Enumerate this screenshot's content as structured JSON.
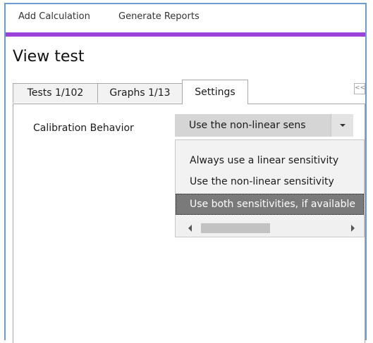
{
  "menu": {
    "items": [
      {
        "label": "Add Calculation"
      },
      {
        "label": "Generate Reports"
      }
    ]
  },
  "colors": {
    "accent": "#9b42d8",
    "window_border": "#6d9bd6",
    "selected_option": "#7a7a7a"
  },
  "page": {
    "title": "View test"
  },
  "tabs": [
    {
      "label": "Tests 1/102"
    },
    {
      "label": "Graphs 1/13"
    },
    {
      "label": "Settings",
      "active": true
    }
  ],
  "collapse": {
    "label": "<<",
    "icon": "double-chevron-left-icon"
  },
  "settings": {
    "calibration": {
      "label": "Calibration Behavior",
      "selected_value": "Use the non-linear sens",
      "options": [
        {
          "label": "Always use a linear sensitivity"
        },
        {
          "label": "Use the non-linear sensitivity"
        },
        {
          "label": "Use both sensitivities, if available",
          "highlighted": true
        }
      ]
    }
  }
}
